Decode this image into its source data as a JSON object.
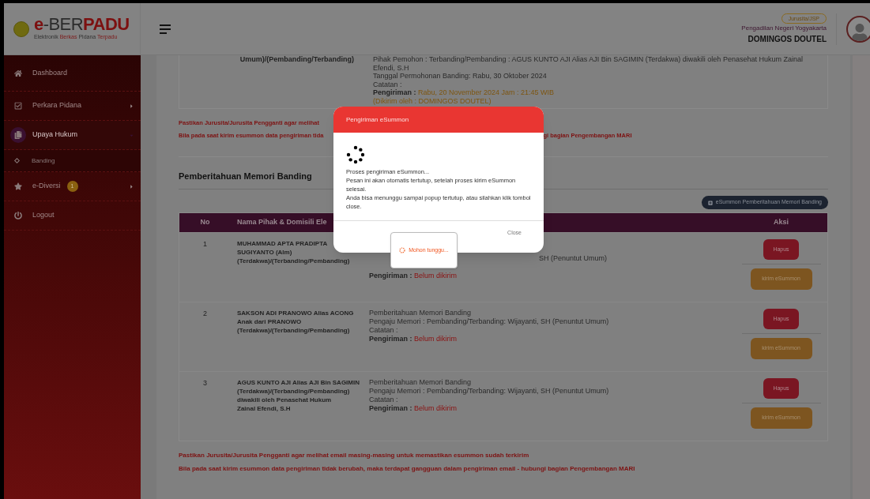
{
  "header": {
    "logo_title": [
      {
        "text": "e",
        "accent": true
      },
      {
        "text": "-BER",
        "accent": false
      },
      {
        "text": "PADU",
        "accent": true
      }
    ],
    "logo_subtitle": [
      {
        "text": "Elektronik ",
        "accent": false
      },
      {
        "text": "Berkas",
        "accent": true
      },
      {
        "text": " Pidana ",
        "accent": false
      },
      {
        "text": "Terpadu",
        "accent": true
      }
    ],
    "role_badge": "Jurusita/JSP",
    "court": "Pengadilan Negeri Yogyakarta",
    "user_name": "DOMINGOS DOUTEL"
  },
  "sidebar": {
    "items": [
      {
        "kind": "home",
        "label": "Dashboard",
        "selected": false
      },
      {
        "kind": "check",
        "label": "Perkara Pidana",
        "selected": false,
        "expanded": false
      },
      {
        "kind": "copy",
        "label": "Upaya Hukum",
        "selected": true,
        "expanded": true,
        "children": [
          {
            "label": "Banding"
          }
        ]
      },
      {
        "kind": "star",
        "label": "e-Diversi",
        "badge": "1",
        "selected": false,
        "expanded": false
      },
      {
        "kind": "power",
        "label": "Logout",
        "selected": false
      }
    ]
  },
  "previous_row": {
    "name_tail": "Umum)/(Pembanding/Terbanding)",
    "lines": [
      {
        "kind": "plain",
        "text": "Pihak Pemohon : Terbanding/Pembanding : AGUS KUNTO AJI Alias AJI Bin SAGIMIN (Terdakwa) diwakili oleh Penasehat Hukum Zainal"
      },
      {
        "kind": "plain",
        "text": "Efendi, S.H"
      },
      {
        "kind": "plain",
        "text": "Tanggal Permohonan Banding: Rabu, 30 Oktober 2024"
      },
      {
        "kind": "plain",
        "text": "Catatan :"
      },
      {
        "kind": "status",
        "label": "Pengiriman :",
        "value": "Rabu, 20 November 2024 Jam : 21:45 WIB",
        "sent": true
      },
      {
        "kind": "note",
        "text": "(Dikirim oleh : DOMINGOS DOUTEL)"
      }
    ]
  },
  "top_warnings": [
    {
      "left": "Pastikan Jurusita/Jurusita Pengganti agar melihat"
    },
    {
      "left": "Bila pada saat kirim esummon data pengiriman tida",
      "right": "gi bagian Pengembangan MARI"
    }
  ],
  "section_title": "Pemberitahuan Memori Banding",
  "esummon_button": "eSummon Pemberitahuan Memori Banding",
  "table": {
    "columns": [
      "No",
      "Nama Pihak & Domisili Ele",
      "Aksi"
    ],
    "rows": [
      {
        "no": "1",
        "name": [
          "MUHAMMAD APTA PRADIPTA",
          "SUGIYANTO (Alm)",
          "(Terdakwa)/(Terbanding/Pembanding)"
        ],
        "covered": true,
        "lines": [
          {
            "kind": "plain",
            "text": "SH (Penuntut Umum)"
          },
          {
            "kind": "status",
            "label": "Pengiriman :",
            "value": "Belum dikirim",
            "sent": false
          }
        ],
        "actions": [
          "Hapus",
          "kirim eSummon"
        ]
      },
      {
        "no": "2",
        "name": [
          "SAKSON ADI PRANOWO Alias ACONG",
          "Anak dari PRANOWO",
          "(Terdakwa)/(Terbanding/Pembanding)"
        ],
        "covered": false,
        "lines": [
          {
            "kind": "plain",
            "text": "Pemberitahuan Memori Banding"
          },
          {
            "kind": "plain",
            "text": "Pengaju Memori : Pembanding/Terbanding: Wijayanti, SH (Penuntut Umum)"
          },
          {
            "kind": "plain",
            "text": "Catatan :"
          },
          {
            "kind": "status",
            "label": "Pengiriman :",
            "value": "Belum dikirim",
            "sent": false
          }
        ],
        "actions": [
          "Hapus",
          "kirim eSummon"
        ]
      },
      {
        "no": "3",
        "name": [
          "AGUS KUNTO AJI Alias AJI Bin SAGIMIN",
          "(Terdakwa)/(Terbanding/Pembanding)",
          "diwakili oleh Penasehat Hukum",
          "Zainal Efendi, S.H"
        ],
        "covered": false,
        "lines": [
          {
            "kind": "plain",
            "text": "Pemberitahuan Memori Banding"
          },
          {
            "kind": "plain",
            "text": "Pengaju Memori : Pembanding/Terbanding: Wijayanti, SH (Penuntut Umum)"
          },
          {
            "kind": "plain",
            "text": "Catatan :"
          },
          {
            "kind": "status",
            "label": "Pengiriman :",
            "value": "Belum dikirim",
            "sent": false
          }
        ],
        "actions": [
          "Hapus",
          "kirim eSummon"
        ]
      }
    ]
  },
  "bottom_warnings": [
    "Pastikan Jurusita/Jurusita Pengganti agar melihat email masing-masing untuk memastikan esummon sudah terkirim",
    "Bila pada saat kirim esummon data pengiriman tidak berubah, maka terdapat gangguan dalam pengiriman email - hubungi bagian Pengembangan MARI"
  ],
  "modal": {
    "title": "Pengiriman eSummon",
    "lines": [
      "Proses pengiriman eSummon...",
      "Pesan ini akan otomatis tertutup, setelah proses kirim eSummon selesai.",
      "Anda bisa menunggu sampai popup tertutup, atau silahkan klik tombol close."
    ],
    "loading_text": "Mohon tunggu...",
    "close": "Close"
  }
}
